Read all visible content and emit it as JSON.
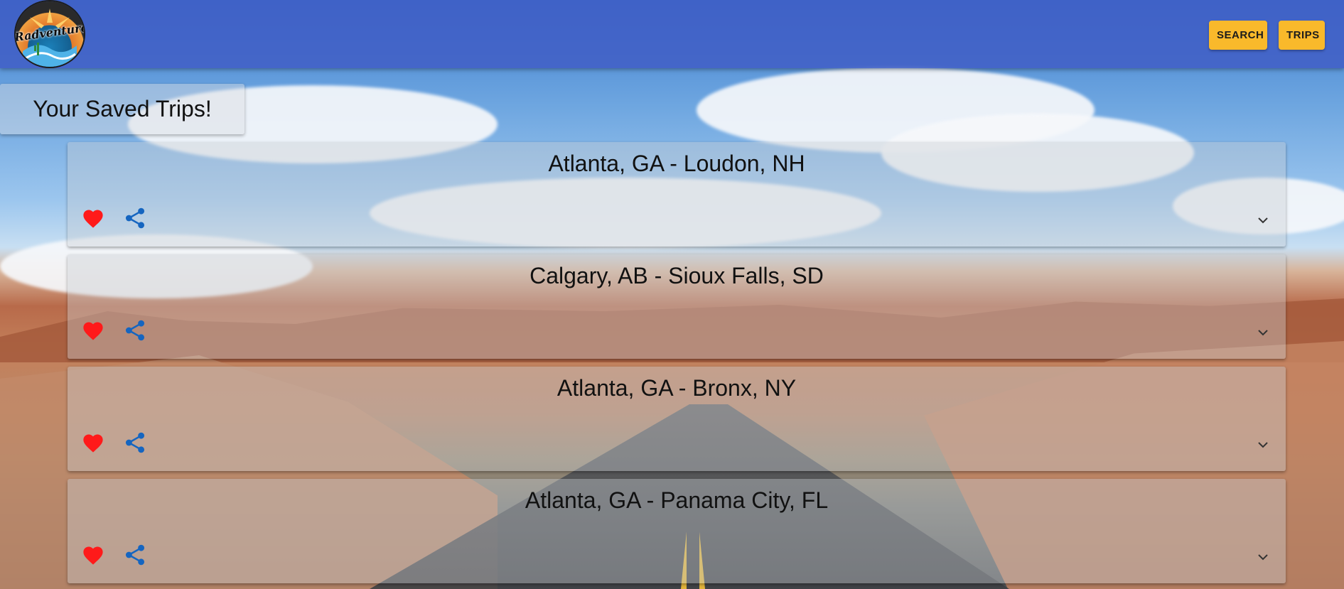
{
  "app": {
    "logo_text": "Radventure"
  },
  "header": {
    "search_label": "SEARCH",
    "trips_label": "TRIPS"
  },
  "page": {
    "title": "Your Saved Trips!"
  },
  "trips": [
    {
      "title": "Atlanta, GA - Loudon, NH",
      "favorited": true
    },
    {
      "title": "Calgary, AB - Sioux Falls, SD",
      "favorited": true
    },
    {
      "title": "Atlanta, GA - Bronx, NY",
      "favorited": true
    },
    {
      "title": "Atlanta, GA - Panama City, FL",
      "favorited": true
    }
  ],
  "icons": {
    "favorite": "heart-icon",
    "share": "share-icon",
    "expand": "chevron-down-icon"
  },
  "colors": {
    "appbar": "#3f5cc5",
    "button": "#f9b92b",
    "heart": "#ff1a1a",
    "share": "#1565c0"
  }
}
